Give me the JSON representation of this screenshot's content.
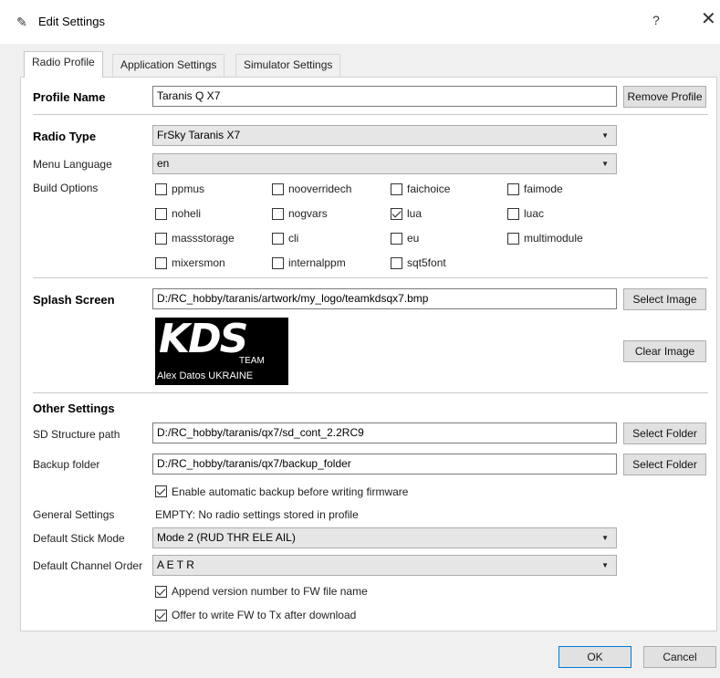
{
  "window": {
    "title": "Edit Settings",
    "help": "?",
    "close": "✕"
  },
  "tabs": [
    {
      "label": "Radio Profile"
    },
    {
      "label": "Application Settings"
    },
    {
      "label": "Simulator Settings"
    }
  ],
  "profile": {
    "name_label": "Profile Name",
    "name_value": "Taranis Q X7",
    "remove_label": "Remove Profile",
    "radio_type_label": "Radio Type",
    "radio_type_value": "FrSky Taranis X7",
    "menu_language_label": "Menu Language",
    "menu_language_value": "en",
    "build_options_label": "Build Options",
    "build_options": [
      {
        "label": "ppmus",
        "checked": false
      },
      {
        "label": "nooverridech",
        "checked": false
      },
      {
        "label": "faichoice",
        "checked": false
      },
      {
        "label": "faimode",
        "checked": false
      },
      {
        "label": "noheli",
        "checked": false
      },
      {
        "label": "nogvars",
        "checked": false
      },
      {
        "label": "lua",
        "checked": true
      },
      {
        "label": "luac",
        "checked": false
      },
      {
        "label": "massstorage",
        "checked": false
      },
      {
        "label": "cli",
        "checked": false
      },
      {
        "label": "eu",
        "checked": false
      },
      {
        "label": "multimodule",
        "checked": false
      },
      {
        "label": "mixersmon",
        "checked": false
      },
      {
        "label": "internalppm",
        "checked": false
      },
      {
        "label": "sqt5font",
        "checked": false
      }
    ]
  },
  "splash": {
    "label": "Splash Screen",
    "path": "D:/RC_hobby/taranis/artwork/my_logo/teamkdsqx7.bmp",
    "select_label": "Select Image",
    "clear_label": "Clear Image",
    "image_big": "KDS",
    "image_team": "TEAM",
    "image_line": "Alex Datos  UKRAINE"
  },
  "other": {
    "heading": "Other Settings",
    "sd_label": "SD Structure path",
    "sd_value": "D:/RC_hobby/taranis/qx7/sd_cont_2.2RC9",
    "backup_label": "Backup folder",
    "backup_value": "D:/RC_hobby/taranis/qx7/backup_folder",
    "select_folder_label": "Select Folder",
    "auto_backup_label": "Enable automatic backup before writing firmware",
    "auto_backup_checked": true,
    "general_label": "General Settings",
    "general_value": "EMPTY: No radio settings stored in profile",
    "stick_mode_label": "Default Stick Mode",
    "stick_mode_value": "Mode 2 (RUD THR ELE AIL)",
    "channel_order_label": "Default Channel Order",
    "channel_order_value": "A E T R",
    "append_version_label": "Append version number to FW file name",
    "append_version_checked": true,
    "offer_write_label": "Offer to write FW to Tx after download",
    "offer_write_checked": true
  },
  "footer": {
    "ok_label": "OK",
    "cancel_label": "Cancel"
  },
  "colors": {
    "accent": "#0078d7",
    "panel": "#ffffff",
    "window_bg": "#f0f0f0"
  }
}
